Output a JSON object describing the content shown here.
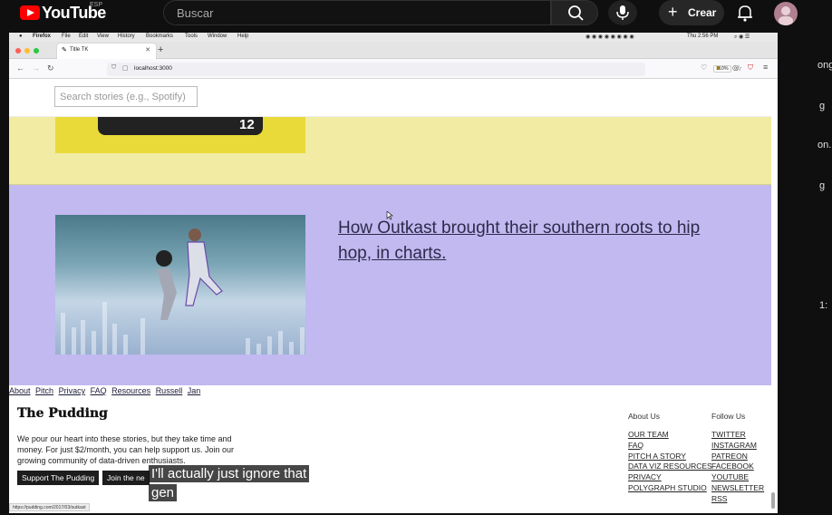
{
  "youtube": {
    "logo_text": "YouTube",
    "country_code": "ESP",
    "search_placeholder": "Buscar",
    "create_label": "Crear"
  },
  "side_fragments": [
    "ong",
    "g",
    "on.",
    "g",
    "1:"
  ],
  "mac_menubar": {
    "app": "Firefox",
    "menus": [
      "File",
      "Edit",
      "View",
      "History",
      "Bookmarks",
      "Tools",
      "Window",
      "Help"
    ],
    "clock": "Thu 2:56 PM"
  },
  "browser": {
    "tab_title": "Title TK",
    "url": "localhost:3000",
    "zoom": "110%"
  },
  "page": {
    "search_placeholder": "Search stories (e.g., Spotify)",
    "yellow_card_number": "12",
    "purple_card_title": "How Outkast brought their southern roots to hip hop, in charts.",
    "footer_links": [
      "About",
      "Pitch",
      "Privacy",
      "FAQ",
      "Resources",
      "Russell",
      "Jan"
    ],
    "pudding_logo": "The Pudding",
    "pudding_copy": "We pour our heart into these stories, but they take time and money. For just $2/month, you can help support us. Join our growing community of data-driven enthusiasts.",
    "support_button": "Support The Pudding",
    "join_button": "Join the ne",
    "about_heading": "About Us",
    "about_items": [
      "OUR TEAM",
      "FAQ",
      "PITCH A STORY",
      "DATA VIZ RESOURCES",
      "PRIVACY",
      "POLYGRAPH STUDIO"
    ],
    "follow_heading": "Follow Us",
    "follow_items": [
      "TWITTER",
      "INSTAGRAM",
      "PATREON",
      "FACEBOOK",
      "YOUTUBE",
      "NEWSLETTER",
      "RSS"
    ],
    "status_url": "https://pudding.com/2017/03/outkast"
  },
  "captions": {
    "line1": "I'll actually just ignore that",
    "line2": "gen"
  },
  "colors": {
    "yellow_card": "#f2eba4",
    "purple_card": "#c1b9f0",
    "youtube_red": "#ff0000"
  }
}
